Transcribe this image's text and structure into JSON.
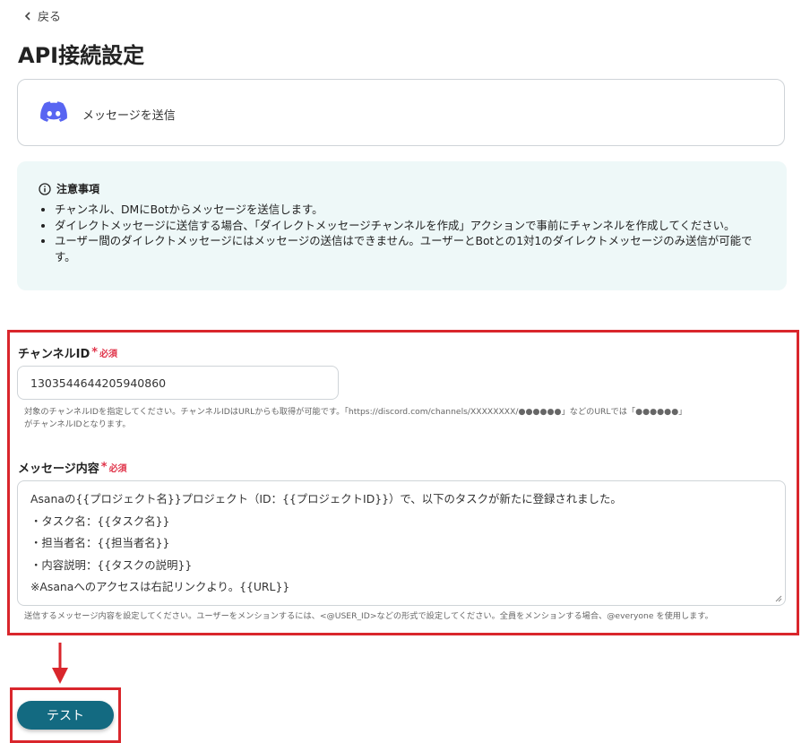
{
  "nav": {
    "back_label": "戻る"
  },
  "page": {
    "title": "API接続設定"
  },
  "action": {
    "label": "メッセージを送信",
    "icon": "discord-icon",
    "icon_color": "#5865f2"
  },
  "notice": {
    "heading": "注意事項",
    "items": [
      "チャンネル、DMにBotからメッセージを送信します。",
      "ダイレクトメッセージに送信する場合、「ダイレクトメッセージチャンネルを作成」アクションで事前にチャンネルを作成してください。",
      "ユーザー間のダイレクトメッセージにはメッセージの送信はできません。ユーザーとBotとの1対1のダイレクトメッセージのみ送信が可能です。"
    ],
    "background": "#eef8f8"
  },
  "channel_field": {
    "label": "チャンネルID",
    "required_star": "*",
    "required_text": "必須",
    "value": "1303544644205940860",
    "help_line1": "対象のチャンネルIDを指定してください。チャンネルIDはURLからも取得が可能です。「https://discord.com/channels/XXXXXXXX/●●●●●●」などのURLでは「●●●●●●」",
    "help_line2": "がチャンネルIDとなります。"
  },
  "message_field": {
    "label": "メッセージ内容",
    "required_star": "*",
    "required_text": "必須",
    "lines": [
      "Asanaの{{プロジェクト名}}プロジェクト（ID：{{プロジェクトID}}）で、以下のタスクが新たに登録されました。",
      "・タスク名：{{タスク名}}",
      "・担当者名：{{担当者名}}",
      "・内容説明：{{タスクの説明}}",
      "※Asanaへのアクセスは右記リンクより。{{URL}}"
    ],
    "help": "送信するメッセージ内容を設定してください。ユーザーをメンションするには、<@USER_ID>などの形式で設定してください。全員をメンションする場合、@everyone を使用します。"
  },
  "test_button": {
    "label": "テスト",
    "color": "#136a81"
  },
  "annotation": {
    "highlight_color": "#d9262c"
  }
}
